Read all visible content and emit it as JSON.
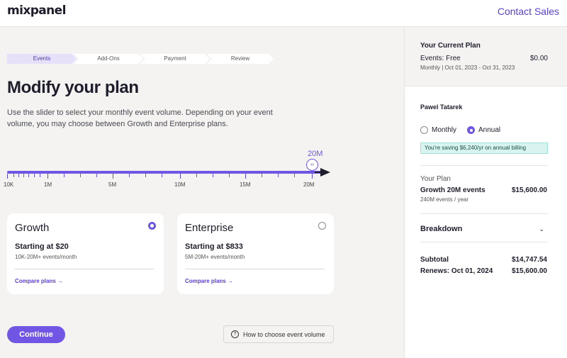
{
  "header": {
    "logo": "mixpanel",
    "contact_sales": "Contact Sales"
  },
  "stepper": {
    "steps": [
      {
        "label": "Events",
        "active": true
      },
      {
        "label": "Add-Ons",
        "active": false
      },
      {
        "label": "Payment",
        "active": false
      },
      {
        "label": "Review",
        "active": false
      }
    ]
  },
  "main": {
    "title": "Modify your plan",
    "description": "Use the slider to select your monthly event volume. Depending on your event volume, you may choose between Growth and Enterprise plans."
  },
  "slider": {
    "selected_label": "20M",
    "tick_labels": [
      "10K",
      "1M",
      "5M",
      "10M",
      "15M",
      "20M"
    ],
    "handle_icon": "code-brackets-icon"
  },
  "plans": {
    "growth": {
      "name": "Growth",
      "price": "Starting at $20",
      "events": "10K-20M+ events/month",
      "compare": "Compare plans →",
      "selected": true
    },
    "enterprise": {
      "name": "Enterprise",
      "price": "Starting at $833",
      "events": "5M-20M+ events/month",
      "compare": "Compare plans →",
      "selected": false
    }
  },
  "actions": {
    "continue": "Continue",
    "howto": "How to choose event volume",
    "help_icon_glyph": "?"
  },
  "sidebar": {
    "current_plan": {
      "title": "Your Current Plan",
      "events": "Events: Free",
      "price": "$0.00",
      "period": "Monthly | Oct 01, 2023 - Oct 31, 2023"
    },
    "user_name": "Pawel Tatarek",
    "billing": {
      "monthly": "Monthly",
      "annual": "Annual",
      "selected": "annual",
      "saving": "You're saving $6,240/yr on annual billing"
    },
    "your_plan": {
      "title": "Your Plan",
      "name": "Growth 20M events",
      "price": "$15,600.00",
      "sub": "240M events / year"
    },
    "breakdown": "Breakdown",
    "chevron_glyph": "⌄",
    "subtotal_label": "Subtotal",
    "subtotal_value": "$14,747.54",
    "renews_label": "Renews: Oct 01, 2024",
    "renews_value": "$15,600.00"
  },
  "colors": {
    "accent": "#7156e6",
    "link": "#5b3fd6",
    "saving_bg": "#d8f4f1"
  }
}
